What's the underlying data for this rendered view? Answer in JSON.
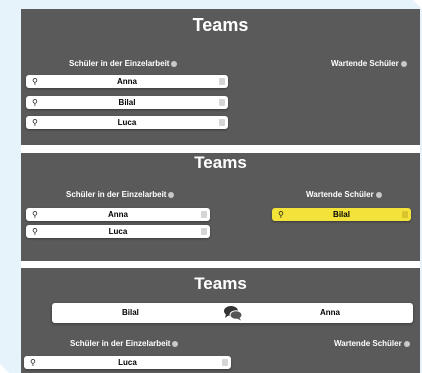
{
  "screens": [
    {
      "title": "Teams",
      "solo_heading": "Schüler in der Einzelarbeit",
      "waiting_heading": "Wartende Schüler",
      "solo_students": [
        "Anna",
        "Bilal",
        "Luca"
      ]
    },
    {
      "title": "Teams",
      "solo_heading": "Schüler in der Einzelarbeit",
      "waiting_heading": "Wartende Schüler",
      "solo_students": [
        "Anna",
        "Luca"
      ],
      "waiting_students": [
        "Bilal"
      ]
    },
    {
      "title": "Teams",
      "team": [
        "Bilal",
        "Anna"
      ],
      "solo_heading": "Schüler in der Einzelarbeit",
      "waiting_heading": "Wartende Schüler",
      "solo_students": [
        "Luca"
      ]
    }
  ],
  "icons": {
    "row_left": "key-icon",
    "row_right": "trash-icon",
    "heading_info": "info-icon",
    "team_link": "chat-bubbles-icon"
  },
  "colors": {
    "panel": "#5a5a5a",
    "waiting_highlight": "#f3e23a"
  }
}
